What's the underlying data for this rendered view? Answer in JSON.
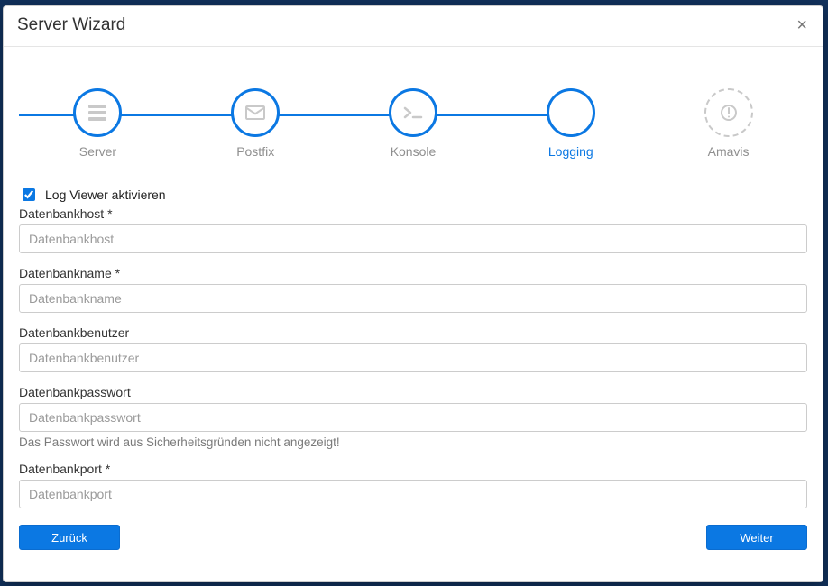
{
  "modal": {
    "title": "Server Wizard"
  },
  "stepper": {
    "steps": [
      {
        "label": "Server",
        "state": "done",
        "icon": "server"
      },
      {
        "label": "Postfix",
        "state": "done",
        "icon": "mail"
      },
      {
        "label": "Konsole",
        "state": "done",
        "icon": "terminal"
      },
      {
        "label": "Logging",
        "state": "current",
        "icon": "none"
      },
      {
        "label": "Amavis",
        "state": "pending",
        "icon": "alert"
      }
    ]
  },
  "form": {
    "logviewer": {
      "label": "Log Viewer aktivieren",
      "checked": true
    },
    "dbhost": {
      "label": "Datenbankhost *",
      "placeholder": "Datenbankhost",
      "value": ""
    },
    "dbname": {
      "label": "Datenbankname *",
      "placeholder": "Datenbankname",
      "value": ""
    },
    "dbuser": {
      "label": "Datenbankbenutzer",
      "placeholder": "Datenbankbenutzer",
      "value": ""
    },
    "dbpass": {
      "label": "Datenbankpasswort",
      "placeholder": "Datenbankpasswort",
      "value": "",
      "hint": "Das Passwort wird aus Sicherheitsgründen nicht angezeigt!"
    },
    "dbport": {
      "label": "Datenbankport *",
      "placeholder": "Datenbankport",
      "value": ""
    }
  },
  "buttons": {
    "back": "Zurück",
    "next": "Weiter"
  }
}
